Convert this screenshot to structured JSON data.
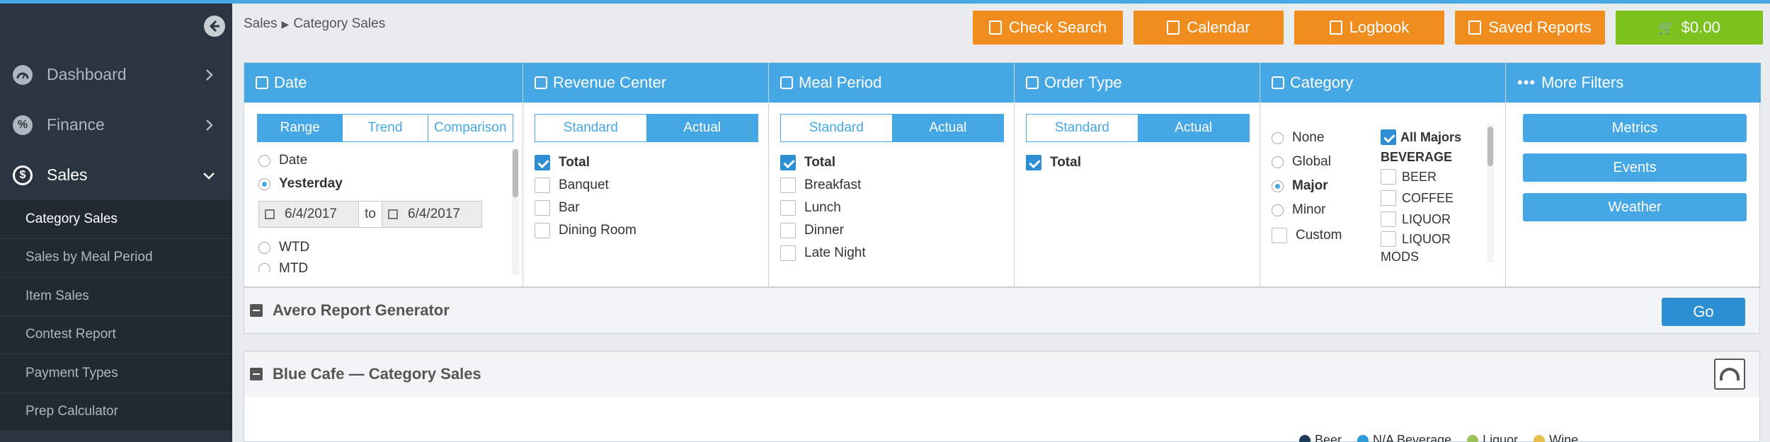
{
  "sidebar": {
    "nav": [
      {
        "label": "Dashboard",
        "icon": "dashboard-icon",
        "glyph": ""
      },
      {
        "label": "Finance",
        "icon": "percent-icon",
        "glyph": "%"
      },
      {
        "label": "Sales",
        "icon": "dollar-icon",
        "glyph": "$"
      }
    ],
    "sub": [
      "Category Sales",
      "Sales by Meal Period",
      "Item Sales",
      "Contest Report",
      "Payment Types",
      "Prep Calculator"
    ]
  },
  "breadcrumb": {
    "parent": "Sales",
    "sep": "▶",
    "current": "Category Sales"
  },
  "topbar": {
    "check_search": "Check Search",
    "calendar": "Calendar",
    "logbook": "Logbook",
    "saved_reports": "Saved Reports",
    "cart_glyph": "🛒",
    "cart_total": "$0.00"
  },
  "filters": {
    "date": {
      "title": "Date",
      "modes": [
        "Range",
        "Trend",
        "Comparison"
      ],
      "options": [
        "Date",
        "Yesterday",
        "WTD",
        "MTD"
      ],
      "from": "6/4/2017",
      "to_label": "to",
      "to": "6/4/2017"
    },
    "revenue_center": {
      "title": "Revenue Center",
      "modes": [
        "Standard",
        "Actual"
      ],
      "items": [
        "Total",
        "Banquet",
        "Bar",
        "Dining Room"
      ]
    },
    "meal_period": {
      "title": "Meal Period",
      "modes": [
        "Standard",
        "Actual"
      ],
      "items": [
        "Total",
        "Breakfast",
        "Lunch",
        "Dinner",
        "Late Night"
      ]
    },
    "order_type": {
      "title": "Order Type",
      "modes": [
        "Standard",
        "Actual"
      ],
      "items": [
        "Total"
      ]
    },
    "category": {
      "title": "Category",
      "levels": [
        "None",
        "Global",
        "Major",
        "Minor",
        "Custom"
      ],
      "all_majors": "All Majors",
      "group": "BEVERAGE",
      "items": [
        "BEER",
        "COFFEE",
        "LIQUOR",
        "LIQUOR"
      ],
      "clipped": "MODS"
    },
    "more": {
      "title": "More Filters",
      "buttons": [
        "Metrics",
        "Events",
        "Weather"
      ]
    }
  },
  "report_generator": {
    "title": "Avero Report Generator",
    "go": "Go"
  },
  "cafe": {
    "title": "Blue Cafe — Category Sales",
    "legend": [
      {
        "label": "Beer",
        "color": "#1f3b5a"
      },
      {
        "label": "N/A Beverage",
        "color": "#2d9bd6"
      },
      {
        "label": "Liquor",
        "color": "#9bbf5a"
      },
      {
        "label": "Wine",
        "color": "#e6c04a"
      }
    ]
  },
  "colors": {
    "accent": "#45a7e3",
    "orange": "#ef8d1f",
    "green": "#7cc11d",
    "sidebar": "#2b3541"
  }
}
